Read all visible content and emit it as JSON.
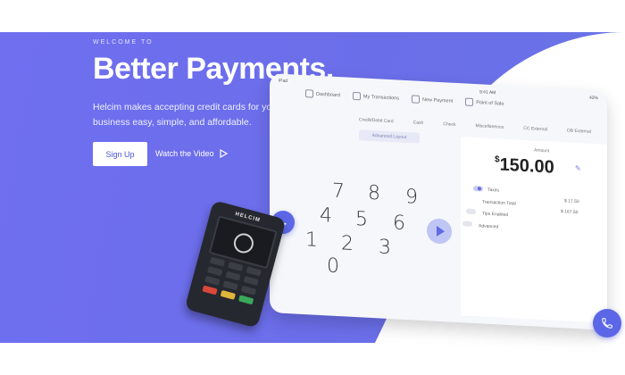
{
  "hero": {
    "welcome": "WELCOME TO",
    "title": "Better Payments.",
    "subtitle": "Helcim makes accepting credit cards for your business easy, simple, and affordable.",
    "signup_label": "Sign Up",
    "watch_label": "Watch the Video"
  },
  "tablet": {
    "status_left": "iPad",
    "status_mid": "9:41 AM",
    "status_right": "42%",
    "nav": [
      "Dashboard",
      "My Transactions",
      "New Payment",
      "Point of Sale"
    ],
    "tabs": [
      "Credit/Debit Card",
      "Cash",
      "Check",
      "Miscellaneous",
      "CC External",
      "DB External"
    ],
    "advanced_layout": "Advanced Layout",
    "keys": [
      "7",
      "8",
      "9",
      "4",
      "5",
      "6",
      "1",
      "2",
      "3",
      "0"
    ],
    "amount_label": "Amount",
    "amount_currency": "$",
    "amount_value": "150.00",
    "rows": [
      {
        "label": "Taxes",
        "value": "$ 17.50"
      },
      {
        "label": "Transaction Total",
        "value": "$ 167.50"
      },
      {
        "label": "Tips Enabled",
        "value": ""
      },
      {
        "label": "Advanced",
        "value": ""
      }
    ]
  },
  "terminal": {
    "brand": "HELCIM"
  },
  "colors": {
    "accent": "#5b67e6",
    "hero_bg": "#6f6ff0"
  }
}
